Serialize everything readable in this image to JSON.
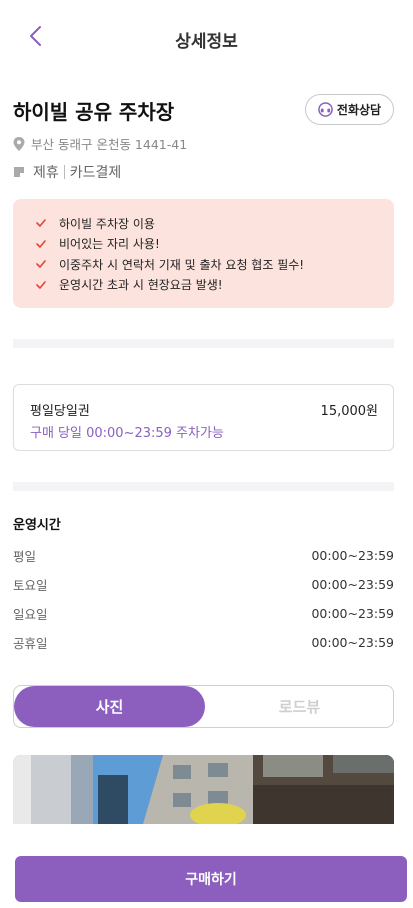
{
  "header": {
    "title": "상세정보",
    "back_icon": "chevron-left-icon"
  },
  "lot": {
    "name": "하이빌 공유 주차장",
    "call_label": "전화상담",
    "address": "부산 동래구 온천동 1441-41",
    "tags": [
      "제휴",
      "카드결제"
    ]
  },
  "notices": [
    "하이빌 주차장 이용",
    "비어있는 자리 사용!",
    "이중주차 시 연락처 기재 및 출차 요청 협조 필수!",
    "운영시간 초과 시 현장요금 발생!"
  ],
  "ticket": {
    "name": "평일당일권",
    "price": "15,000원",
    "description": "구매 당일 00:00~23:59 주차가능"
  },
  "hours": {
    "title": "운영시간",
    "rows": [
      {
        "day": "평일",
        "time": "00:00~23:59"
      },
      {
        "day": "토요일",
        "time": "00:00~23:59"
      },
      {
        "day": "일요일",
        "time": "00:00~23:59"
      },
      {
        "day": "공휴일",
        "time": "00:00~23:59"
      }
    ]
  },
  "tabs": {
    "active": "사진",
    "inactive": "로드뷰"
  },
  "buy_label": "구매하기",
  "colors": {
    "accent": "#8c5fbf",
    "notice_bg": "#fde3dd",
    "check": "#e2463a"
  }
}
